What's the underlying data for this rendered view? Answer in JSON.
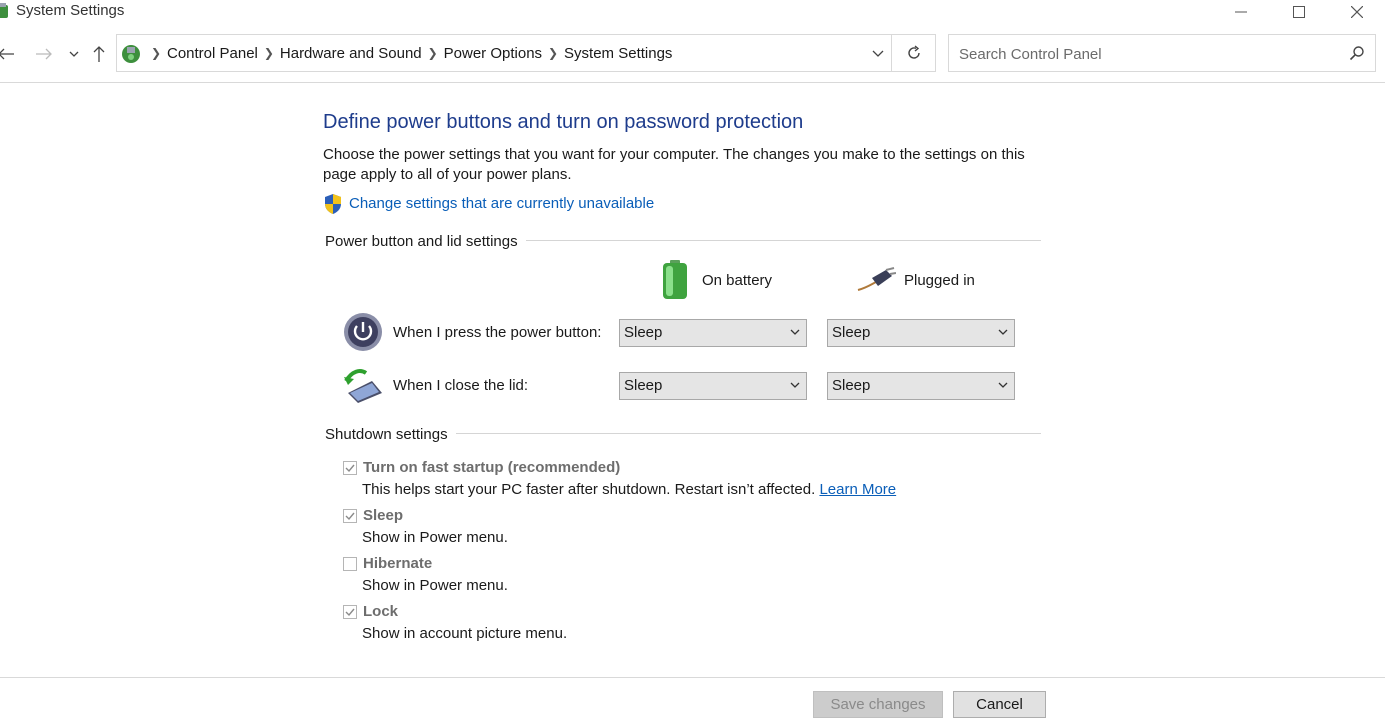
{
  "window": {
    "title": "System Settings"
  },
  "address": {
    "crumbs": [
      "Control Panel",
      "Hardware and Sound",
      "Power Options",
      "System Settings"
    ]
  },
  "search": {
    "placeholder": "Search Control Panel"
  },
  "page": {
    "heading": "Define power buttons and turn on password protection",
    "description": "Choose the power settings that you want for your computer. The changes you make to the settings on this page apply to all of your power plans.",
    "change_link": "Change settings that are currently unavailable"
  },
  "power_group": {
    "label": "Power button and lid settings",
    "col_battery": "On battery",
    "col_plugged": "Plugged in",
    "rows": [
      {
        "label": "When I press the power button:",
        "battery": "Sleep",
        "plugged": "Sleep"
      },
      {
        "label": "When I close the lid:",
        "battery": "Sleep",
        "plugged": "Sleep"
      }
    ]
  },
  "shutdown_group": {
    "label": "Shutdown settings",
    "items": [
      {
        "title": "Turn on fast startup (recommended)",
        "desc": "This helps start your PC faster after shutdown. Restart isn’t affected.",
        "link": "Learn More",
        "checked": true
      },
      {
        "title": "Sleep",
        "desc": "Show in Power menu.",
        "checked": true
      },
      {
        "title": "Hibernate",
        "desc": "Show in Power menu.",
        "checked": false
      },
      {
        "title": "Lock",
        "desc": "Show in account picture menu.",
        "checked": true
      }
    ]
  },
  "buttons": {
    "save": "Save changes",
    "cancel": "Cancel"
  },
  "colors": {
    "heading": "#1e3c8c",
    "link": "#0a5eb8",
    "accent_green": "#4caf50"
  },
  "icons": {
    "title": "control-panel-icon",
    "back": "back-arrow-icon",
    "forward": "forward-arrow-icon",
    "up": "up-arrow-icon",
    "refresh": "refresh-icon",
    "search": "search-icon",
    "shield": "uac-shield-icon",
    "battery": "battery-icon",
    "plug": "power-plug-icon",
    "power_button": "power-button-icon",
    "lid": "laptop-lid-icon"
  }
}
